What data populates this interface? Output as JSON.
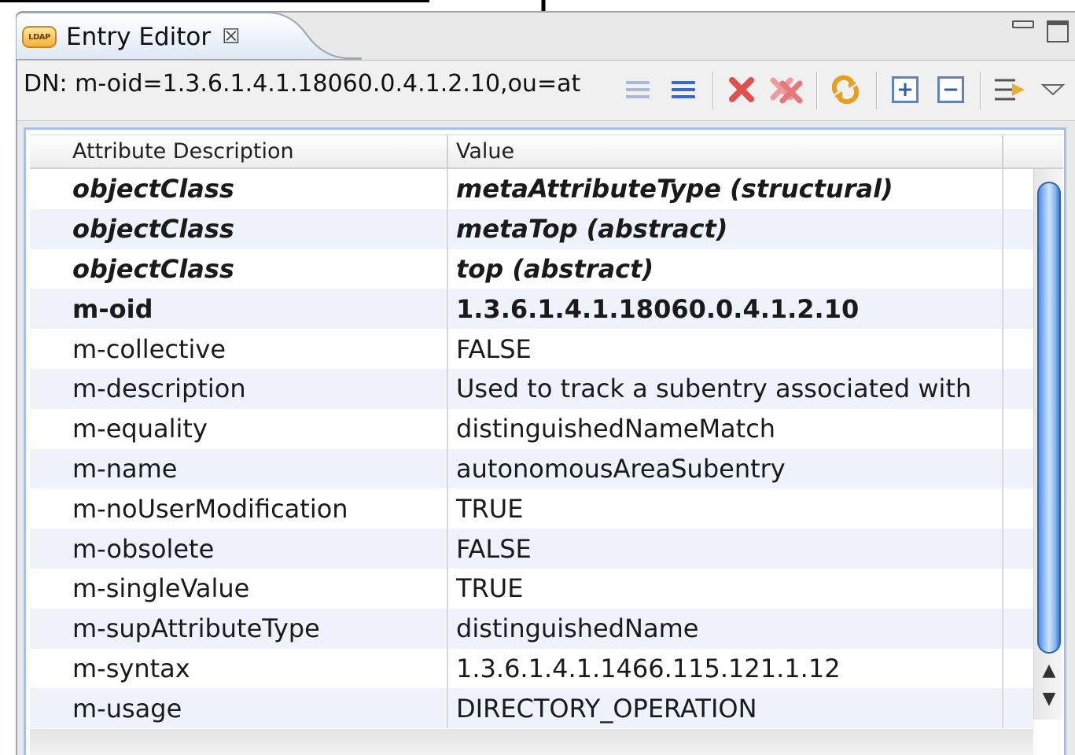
{
  "tab": {
    "icon": "ldap-icon",
    "icon_text": "LDAP",
    "title": "Entry Editor",
    "close_glyph": "☒"
  },
  "toolbar": {
    "dn": "DN: m-oid=1.3.6.1.4.1.18060.0.4.1.2.10,ou=at",
    "buttons": [
      "new-value-icon",
      "new-attribute-icon",
      "delete-icon",
      "delete-all-icon",
      "refresh-icon",
      "expand-all-icon",
      "collapse-all-icon",
      "show-operational-attributes-icon",
      "view-menu-icon"
    ]
  },
  "table": {
    "columns": [
      "Attribute Description",
      "Value"
    ],
    "rows": [
      {
        "attr": "objectClass",
        "value": "metaAttributeType (structural)",
        "style": "bold italic"
      },
      {
        "attr": "objectClass",
        "value": "metaTop (abstract)",
        "style": "bold italic"
      },
      {
        "attr": "objectClass",
        "value": "top (abstract)",
        "style": "bold italic"
      },
      {
        "attr": "m-oid",
        "value": "1.3.6.1.4.1.18060.0.4.1.2.10",
        "style": "bold"
      },
      {
        "attr": "m-collective",
        "value": "FALSE",
        "style": ""
      },
      {
        "attr": "m-description",
        "value": "Used to track a subentry associated with",
        "style": ""
      },
      {
        "attr": "m-equality",
        "value": "distinguishedNameMatch",
        "style": ""
      },
      {
        "attr": "m-name",
        "value": "autonomousAreaSubentry",
        "style": ""
      },
      {
        "attr": "m-noUserModification",
        "value": "TRUE",
        "style": ""
      },
      {
        "attr": "m-obsolete",
        "value": "FALSE",
        "style": ""
      },
      {
        "attr": "m-singleValue",
        "value": "TRUE",
        "style": ""
      },
      {
        "attr": "m-supAttributeType",
        "value": "distinguishedName",
        "style": ""
      },
      {
        "attr": "m-syntax",
        "value": "1.3.6.1.4.1.1466.115.121.1.12",
        "style": ""
      },
      {
        "attr": "m-usage",
        "value": "DIRECTORY_OPERATION",
        "style": ""
      }
    ]
  },
  "colors": {
    "tab_border": "#9da7b4",
    "frame_border": "#a4c2e8",
    "scroll_thumb": "#4f8ee6",
    "delete_red": "#e05050"
  }
}
